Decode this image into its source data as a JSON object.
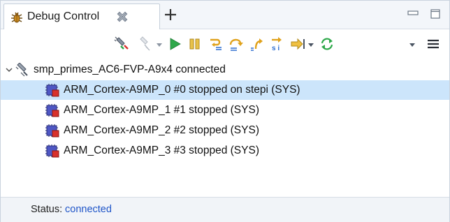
{
  "view": {
    "tab_title": "Debug Control",
    "tab_icon": "debug-bug-icon",
    "close_icon": "close-icon",
    "new_tab_icon": "plus-icon",
    "minimize_icon": "minimize-icon",
    "maximize_icon": "maximize-icon"
  },
  "toolbar": {
    "buttons": [
      "connect-target-icon",
      "disconnect-target-icon",
      "dropdown-arrow-icon",
      "continue-run-icon",
      "interrupt-pause-icon",
      "step-source-line-icon",
      "step-over-icon",
      "step-out-icon",
      "step-instruction-icon",
      "run-to-cursor-icon",
      "dropdown-arrow-icon",
      "refresh-sync-icon",
      "dropdown-arrow-icon",
      "view-menu-icon"
    ]
  },
  "tree": {
    "connection": {
      "label": "smp_primes_AC6-FVP-A9x4 connected",
      "icon": "target-connection-icon",
      "expanded": true
    },
    "cores": [
      {
        "label": "ARM_Cortex-A9MP_0 #0 stopped on stepi (SYS)",
        "icon": "cpu-core-stopped-icon",
        "selected": true
      },
      {
        "label": "ARM_Cortex-A9MP_1 #1 stopped (SYS)",
        "icon": "cpu-core-stopped-icon",
        "selected": false
      },
      {
        "label": "ARM_Cortex-A9MP_2 #2 stopped (SYS)",
        "icon": "cpu-core-stopped-icon",
        "selected": false
      },
      {
        "label": "ARM_Cortex-A9MP_3 #3 stopped (SYS)",
        "icon": "cpu-core-stopped-icon",
        "selected": false
      }
    ]
  },
  "status": {
    "label": "Status:",
    "value": "connected",
    "value_color": "#1f55c8"
  },
  "colors": {
    "selection": "#cce5fb",
    "run_green": "#2ea84a",
    "step_gold": "#e0a21c"
  }
}
